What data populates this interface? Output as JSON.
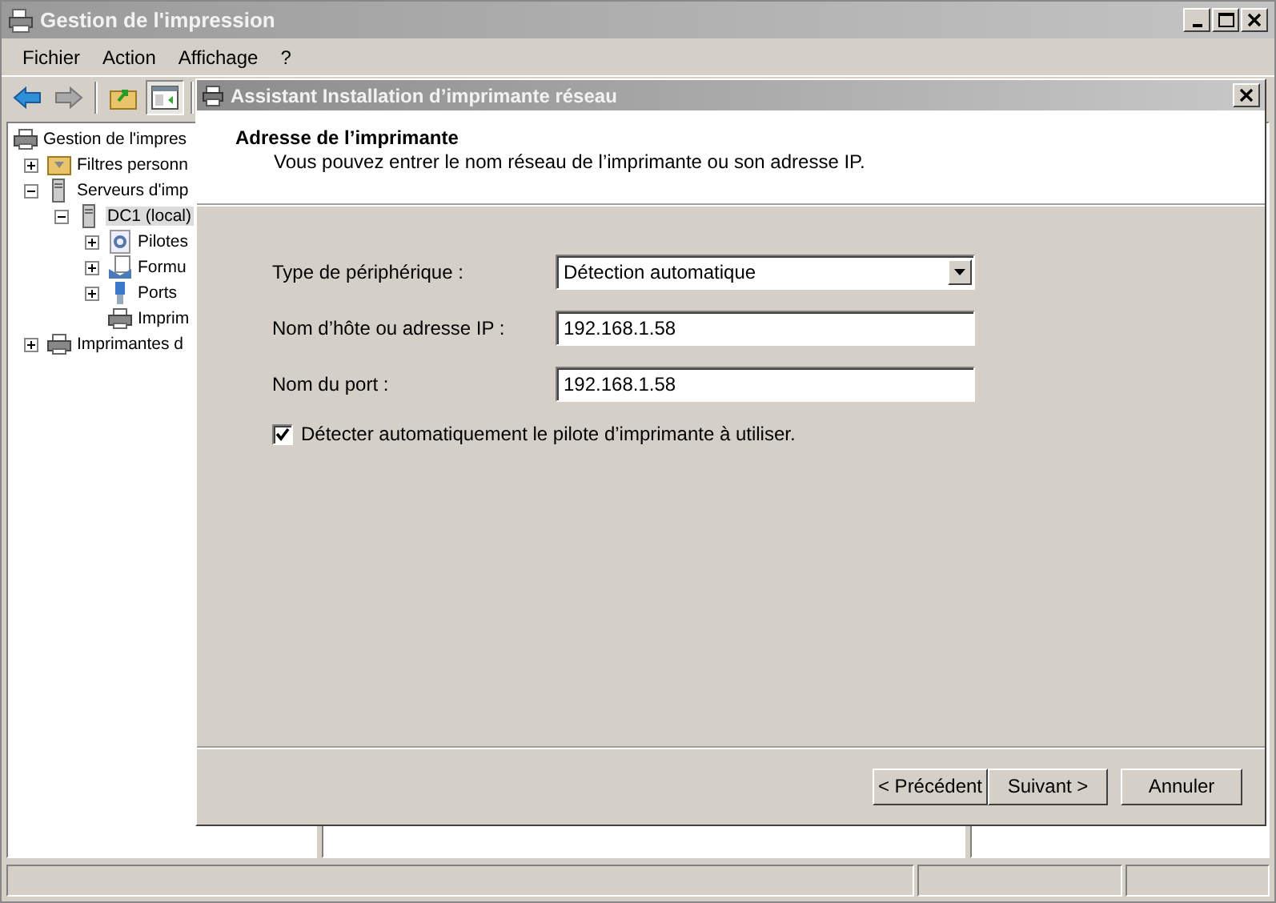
{
  "window": {
    "title": "Gestion de l'impression"
  },
  "menu": [
    "Fichier",
    "Action",
    "Affichage",
    "?"
  ],
  "tree": [
    {
      "label": "Gestion de l'impres",
      "selected": false,
      "children": [
        {
          "label": "Filtres personn",
          "selected": false,
          "expanded": false
        },
        {
          "label": "Serveurs d'imp",
          "selected": false,
          "expanded": true,
          "children": [
            {
              "label": "DC1 (local)",
              "selected": true,
              "expanded": true,
              "children": [
                {
                  "label": "Pilotes",
                  "selected": false,
                  "expanded": false
                },
                {
                  "label": "Formu",
                  "selected": false,
                  "expanded": false
                },
                {
                  "label": "Ports",
                  "selected": false,
                  "expanded": false
                },
                {
                  "label": "Imprim",
                  "selected": false
                }
              ]
            }
          ]
        },
        {
          "label": "Imprimantes d",
          "selected": false,
          "expanded": false
        }
      ]
    }
  ],
  "dialog": {
    "title": "Assistant Installation d’imprimante réseau",
    "heading": "Adresse de l’imprimante",
    "subtitle": "Vous pouvez entrer le nom réseau de l’imprimante ou son adresse IP.",
    "fields": [
      {
        "kind": "select",
        "label": "Type de périphérique :",
        "value": "Détection automatique"
      },
      {
        "kind": "input",
        "label": "Nom d’hôte ou adresse IP :",
        "value": "192.168.1.58"
      },
      {
        "kind": "input",
        "label": "Nom du port :",
        "value": "192.168.1.58"
      }
    ],
    "checkbox": {
      "label": "Détecter automatiquement le pilote d’imprimante à utiliser.",
      "checked": true
    },
    "buttons": [
      "< Précédent",
      "Suivant >",
      "Annuler"
    ]
  }
}
